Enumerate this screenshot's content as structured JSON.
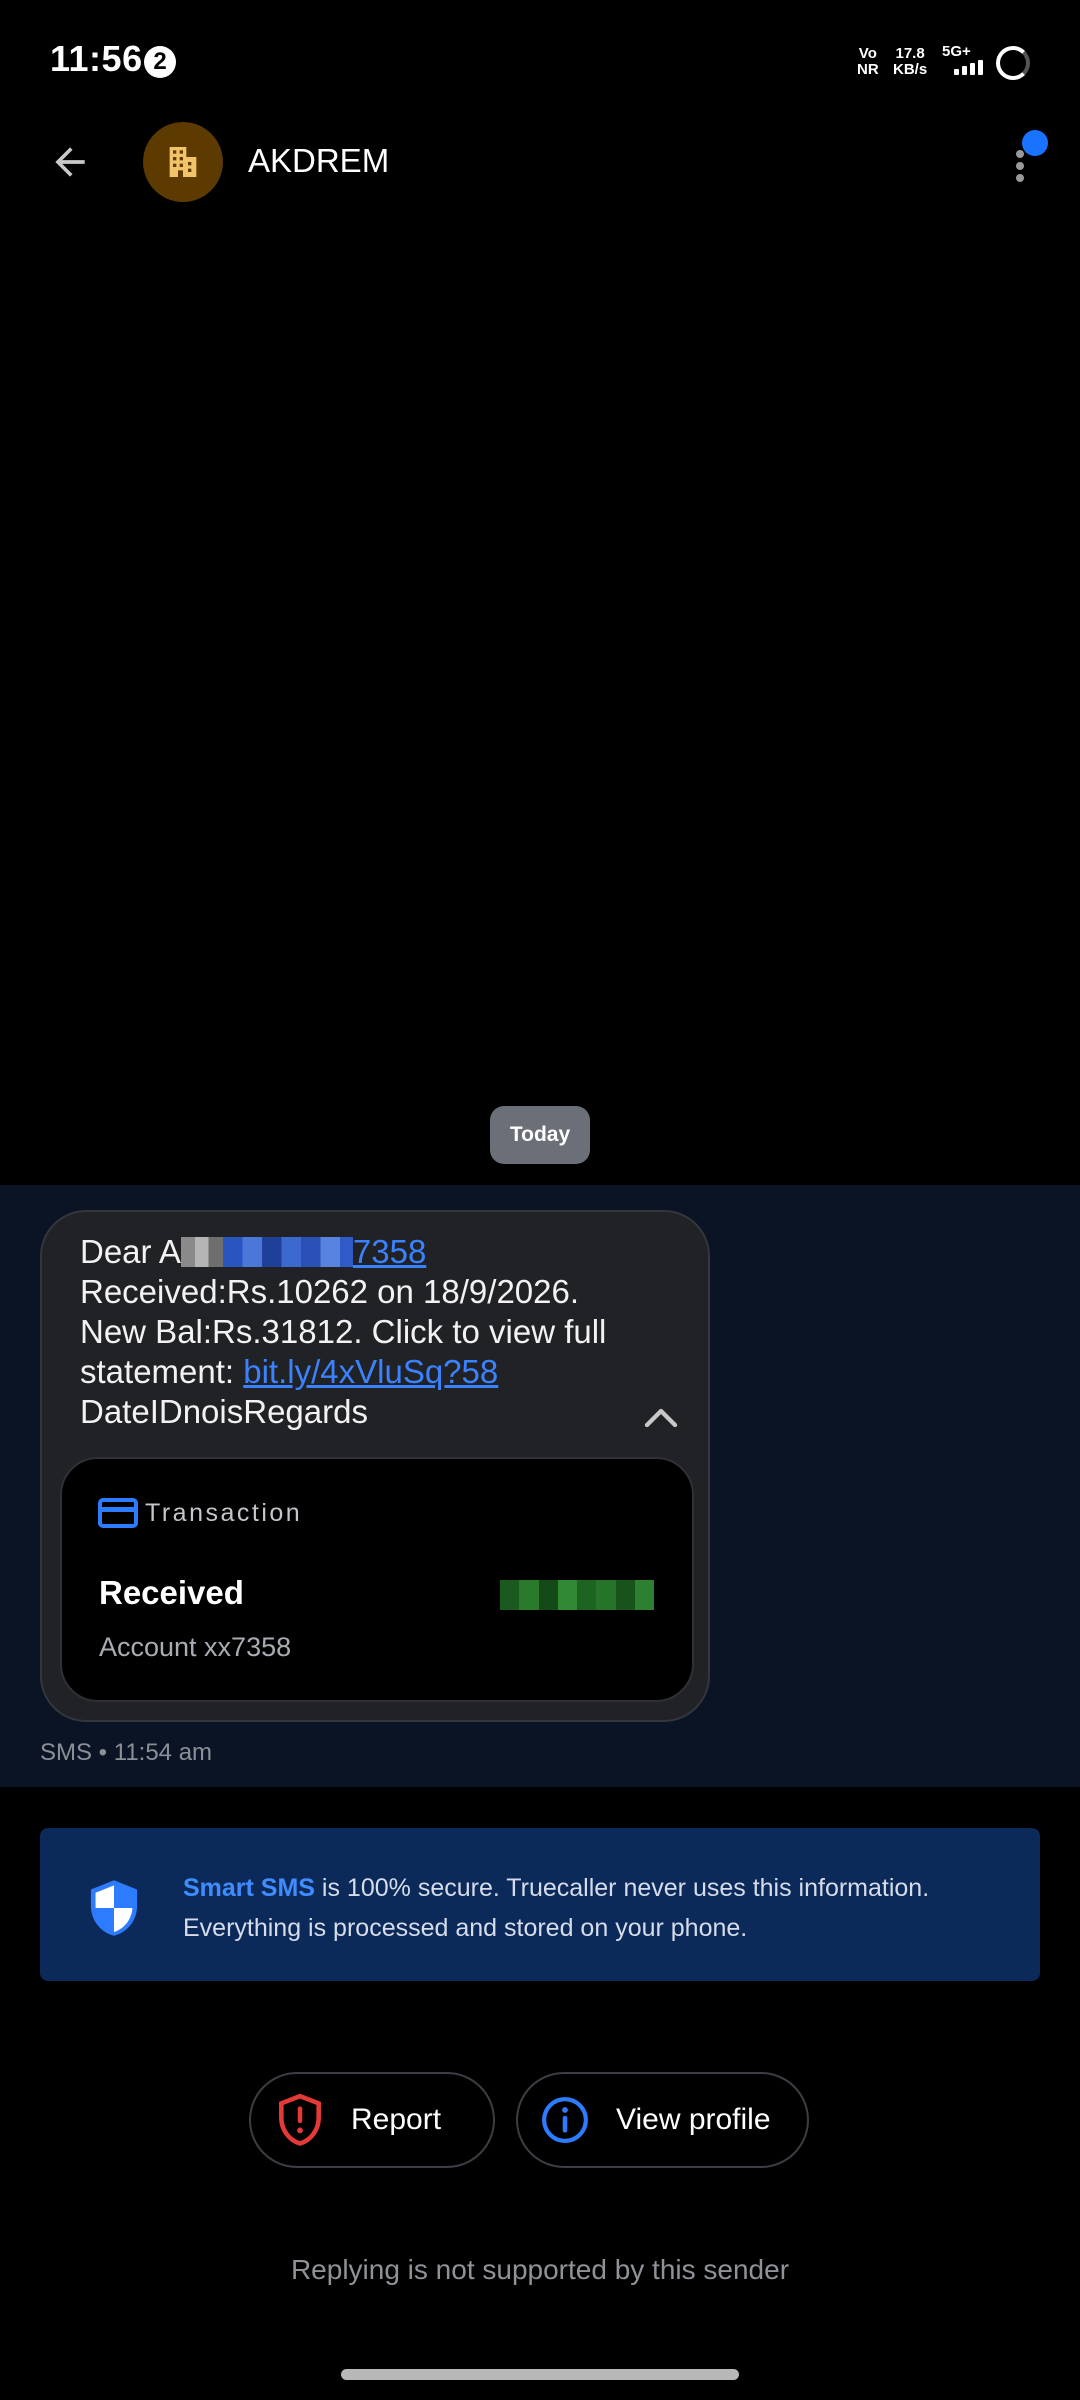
{
  "status_bar": {
    "time": "11:56",
    "notification_count": "2",
    "volte_top": "Vo",
    "volte_bottom": "NR",
    "speed_value": "17.8",
    "speed_unit": "KB/s",
    "network": "5G+"
  },
  "header": {
    "contact_name": "AKDREM",
    "avatar_icon": "building-icon",
    "avatar_color": "#5c3a00",
    "menu_badge_color": "#1a73ff"
  },
  "date_chip": "Today",
  "message": {
    "prefix": "Dear A",
    "account_link_tail": "7358",
    "line2": "Received:Rs.10262 on 18/9/2026.",
    "line3": "New Bal:Rs.31812. Click to view full",
    "line4_prefix": "statement: ",
    "link": "bit.ly/4xVluSq?58",
    "line5": "DateIDnoisRegards",
    "link_color": "#3b82ff"
  },
  "transaction_card": {
    "title": "Transaction",
    "status": "Received",
    "account": "Account xx7358"
  },
  "sms_meta": "SMS • 11:54 am",
  "info_banner": {
    "highlight": "Smart SMS",
    "text_line1": " is 100% secure. Truecaller never uses this information.",
    "text_line2": "Everything is processed and stored on your phone."
  },
  "actions": {
    "report_label": "Report",
    "view_profile_label": "View profile"
  },
  "footer_note": "Replying is not supported by this sender"
}
